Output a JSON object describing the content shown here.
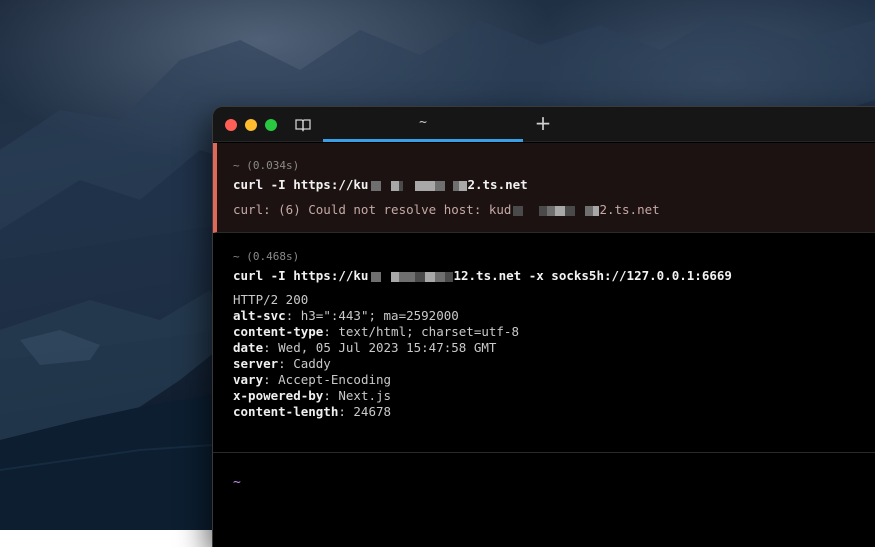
{
  "window": {
    "tab_title": "~",
    "new_tab_label": "+"
  },
  "blocks": [
    {
      "duration": "~ (0.034s)",
      "command_prefix": "curl -I https://ku",
      "command_suffix": "2.ts.net",
      "error_prefix": "curl: (6) Could not resolve host: kud",
      "error_suffix": "2.ts.net",
      "status": "error"
    },
    {
      "duration": "~ (0.468s)",
      "command_prefix": "curl -I https://ku",
      "command_suffix": "12.ts.net -x socks5h://127.0.0.1:6669",
      "status_line": "HTTP/2 200",
      "headers": [
        {
          "key": "alt-svc",
          "value": ": h3=\":443\"; ma=2592000"
        },
        {
          "key": "content-type",
          "value": ": text/html; charset=utf-8"
        },
        {
          "key": "date",
          "value": ": Wed, 05 Jul 2023 15:47:58 GMT"
        },
        {
          "key": "server",
          "value": ": Caddy"
        },
        {
          "key": "vary",
          "value": ": Accept-Encoding"
        },
        {
          "key": "x-powered-by",
          "value": ": Next.js"
        },
        {
          "key": "content-length",
          "value": ": 24678"
        }
      ]
    }
  ],
  "prompt": "~",
  "colors": {
    "error_accent": "#e0685a",
    "tab_accent": "#3aa0e6",
    "prompt": "#c58cf0"
  }
}
